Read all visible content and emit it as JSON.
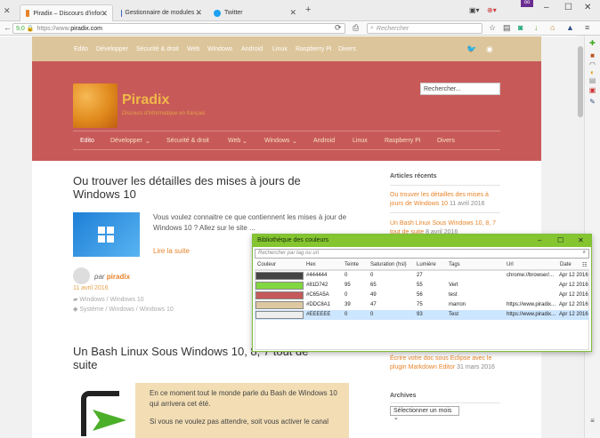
{
  "browser": {
    "tabs": [
      {
        "label": "Piradix – Discours d'infor...",
        "color": "#e7842b"
      },
      {
        "label": "Gestionnaire de modules ...",
        "color": "#3a66c4"
      },
      {
        "label": "Twitter",
        "color": "#1da1f2"
      }
    ],
    "new_tab": "+",
    "url_prefix": "https://www.",
    "url_host": "piradix.com",
    "zoom": "9,0",
    "search_placeholder": "Rechercher"
  },
  "site": {
    "top_nav": [
      "Edito",
      "Développer",
      "Sécurité & droit",
      "Web",
      "Windows",
      "Android",
      "Linux",
      "Raspberry Pi",
      "Divers"
    ],
    "title": "Piradix",
    "subtitle": "Discours d'informatique en français",
    "search_placeholder": "Rechercher...",
    "main_nav": [
      "Edito",
      "Développer",
      "Sécurité & droit",
      "Web",
      "Windows",
      "Android",
      "Linux",
      "Raspberry Pi",
      "Divers"
    ],
    "post1": {
      "title": "Ou trouver les détailles des mises à jours de Windows 10",
      "excerpt": "Vous voulez connaitre ce que contiennent les mises à jour de Windows 10 ? Allez sur le site ...",
      "read_more": "Lire la suite",
      "by": "par",
      "author": "piradix",
      "date": "11 avril 2016",
      "categories": "Windows / Windows 10",
      "tags": "Système / Windows / Windows 10"
    },
    "post2": {
      "title": "Un Bash Linux Sous Windows 10, 8, 7 tout de suite",
      "excerpt1": "En ce moment tout le monde parle du Bash de Windows 10 qui arrivera cet été.",
      "excerpt2": "Si vous ne voulez pas attendre, soit vous activer le canal"
    },
    "sidebar": {
      "recent_title": "Articles récents",
      "recent": [
        {
          "title": "Ou trouver les détailles des mises à jours de Windows 10",
          "date": "11 avril 2016"
        },
        {
          "title": "Un Bash Linux Sous Windows 10, 8, 7 tout de suite",
          "date": "8 avril 2016"
        },
        {
          "title": "Écrire votre doc sous Eclipse avec le plugin Markdown Editor",
          "date": "31 mars 2016"
        }
      ],
      "archives_title": "Archives",
      "archives_select": "Sélectionner un mois"
    }
  },
  "colorlib": {
    "title": "Bibliothèque des couleurs",
    "search_placeholder": "Rechercher par tag ou url",
    "columns": [
      "Couleur",
      "Hex",
      "Teinte",
      "Saturation (hsl)",
      "Lumière",
      "Tags",
      "Url",
      "Date"
    ],
    "rows": [
      {
        "hex": "#444444",
        "hue": "0",
        "sat": "0",
        "light": "27",
        "tag": "",
        "url": "chrome://browser/...",
        "date": "Apr 12 2016"
      },
      {
        "hex": "#81D742",
        "hue": "95",
        "sat": "65",
        "light": "55",
        "tag": "Vert",
        "url": "",
        "date": "Apr 12 2016"
      },
      {
        "hex": "#C65A5A",
        "hue": "0",
        "sat": "49",
        "light": "56",
        "tag": "test",
        "url": "",
        "date": "Apr 12 2016"
      },
      {
        "hex": "#DDC8A1",
        "hue": "39",
        "sat": "47",
        "light": "75",
        "tag": "marron",
        "url": "https://www.piradix...",
        "date": "Apr 12 2016"
      },
      {
        "hex": "#EEEEEE",
        "hue": "0",
        "sat": "0",
        "light": "93",
        "tag": "Test",
        "url": "https://www.piradix...",
        "date": "Apr 12 2016"
      }
    ]
  }
}
